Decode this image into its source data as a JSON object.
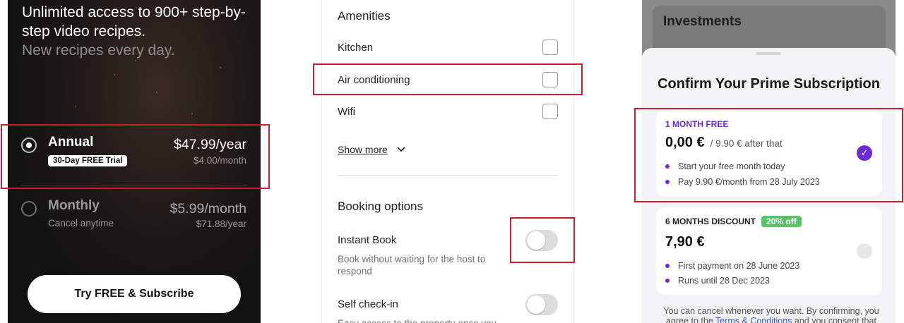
{
  "recipes": {
    "headline": "Unlimited access to 900+ step-by-step video recipes.",
    "subline": "New recipes every day.",
    "annual": {
      "title": "Annual",
      "badge": "30-Day FREE Trial",
      "price": "$47.99/year",
      "sub_price": "$4.00/month"
    },
    "monthly": {
      "title": "Monthly",
      "subtitle": "Cancel anytime",
      "price": "$5.99/month",
      "sub_price": "$71.88/year"
    },
    "cta_label": "Try FREE & Subscribe"
  },
  "filters": {
    "amenities_heading": "Amenities",
    "amenities": [
      {
        "label": "Kitchen",
        "checked": false
      },
      {
        "label": "Air conditioning",
        "checked": false
      },
      {
        "label": "Wifi",
        "checked": false
      }
    ],
    "show_more_label": "Show more",
    "booking_heading": "Booking options",
    "instant_book": {
      "label": "Instant Book",
      "description": "Book without waiting for the host to respond",
      "enabled": false
    },
    "self_checkin": {
      "label": "Self check-in",
      "description": "Easy access to the property once you",
      "enabled": false
    }
  },
  "subscription": {
    "background_title": "Investments",
    "sheet_title": "Confirm Your Prime Subscription",
    "option_free": {
      "kicker": "1 MONTH FREE",
      "price": "0,00 €",
      "after": "/ 9.90 € after that",
      "bullets": [
        "Start your free month today",
        "Pay 9.90 €/month from 28 July 2023"
      ],
      "selected": true
    },
    "option_discount": {
      "kicker": "6 MONTHS DISCOUNT",
      "pill": "20% off",
      "price": "7,90 €",
      "bullets": [
        "First payment on 28 June 2023",
        "Runs until 28 Dec 2023"
      ],
      "selected": false
    },
    "fine_print_1": "You can cancel whenever you want. By confirming, you",
    "fine_print_2a": "agree to the",
    "fine_print_link": "Terms & Conditions",
    "fine_print_2b": "and you consent that"
  },
  "colors": {
    "highlight_red": "#c8202c",
    "prime_purple": "#6b2bd9",
    "discount_green": "#57c46a"
  }
}
